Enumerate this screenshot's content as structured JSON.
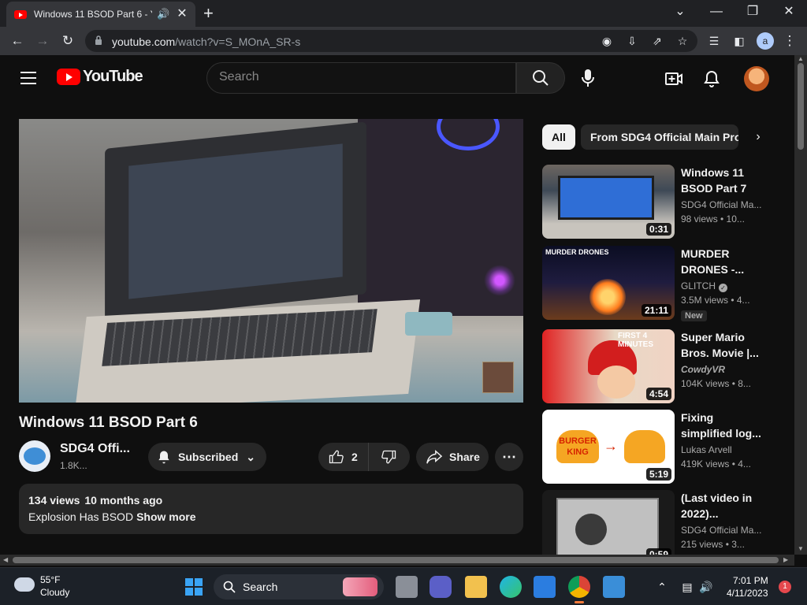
{
  "browser": {
    "tab_title": "Windows 11 BSOD Part 6 - YouTube",
    "tab_title_visible": "Windows 11 BSOD Part 6 - Y",
    "new_tab_glyph": "+",
    "url_host": "youtube.com",
    "url_path": "/watch?v=S_MOnA_SR-s",
    "profile_initial": "a",
    "icons": [
      "back-icon",
      "forward-icon",
      "reload-icon",
      "lock-icon",
      "google-lens-icon",
      "install-icon",
      "share-icon",
      "bookmark-star-icon",
      "media-controls-icon",
      "side-panel-icon",
      "profile-icon",
      "kebab-menu-icon"
    ]
  },
  "masthead": {
    "logo_text": "YouTube",
    "search_placeholder": "Search"
  },
  "video": {
    "title": "Windows 11 BSOD Part 6",
    "channel_name": "SDG4 Offi...",
    "subscribers": "1.8K...",
    "subscribe_label": "Subscribed",
    "like_count": "2",
    "share_label": "Share",
    "views": "134 views",
    "published": "10 months ago",
    "description": "Explosion Has BSOD",
    "show_more": "Show more"
  },
  "sidebar": {
    "chips": [
      "All",
      "From SDG4 Official Main Pro"
    ],
    "recommendations": [
      {
        "title": "Windows 11 BSOD Part 7",
        "channel": "SDG4 Official Ma...",
        "stats": "98 views • 10...",
        "duration": "0:31",
        "verified": false,
        "badge": ""
      },
      {
        "title": "MURDER DRONES -...",
        "channel": "GLITCH",
        "stats": "3.5M views • 4...",
        "duration": "21:11",
        "verified": true,
        "badge": "New",
        "thumb_text": "MURDER DRONES"
      },
      {
        "title": "Super Mario Bros. Movie |...",
        "channel": "CowdyVR",
        "stats": "104K views • 8...",
        "duration": "4:54",
        "verified": false,
        "badge": "",
        "thumb_text": "FIRST 4 MINUTES"
      },
      {
        "title": "Fixing simplified log...",
        "channel": "Lukas Arvell",
        "stats": "419K views • 4...",
        "duration": "5:19",
        "verified": false,
        "badge": "",
        "thumb_text": "BURGER KING"
      },
      {
        "title": "(Last video in 2022)...",
        "channel": "SDG4 Official Ma...",
        "stats": "215 views • 3...",
        "duration": "0:59",
        "verified": false,
        "badge": ""
      }
    ]
  },
  "taskbar": {
    "temperature": "55°F",
    "condition": "Cloudy",
    "search_label": "Search",
    "time": "7:01 PM",
    "date": "4/11/2023",
    "notification_count": "1"
  },
  "colors": {
    "yt_bg": "#0f0f0f",
    "brand_red": "#ff0000",
    "chip_bg": "#272727",
    "chrome_bg": "#35363a"
  }
}
